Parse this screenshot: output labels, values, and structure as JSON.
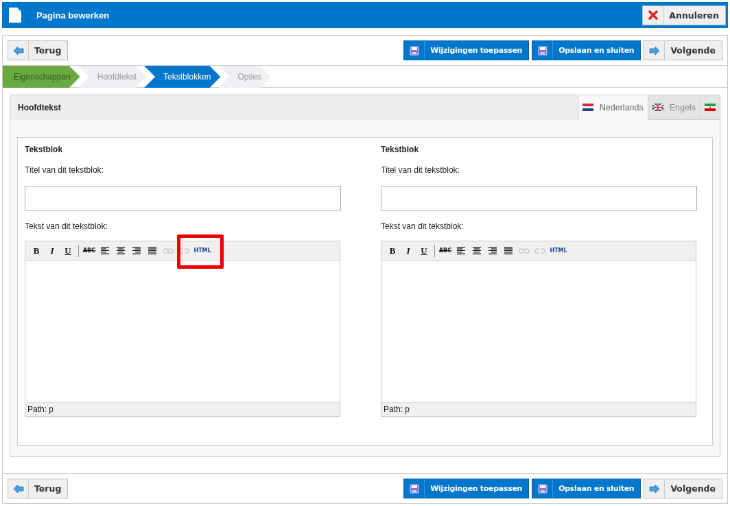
{
  "header": {
    "title": "Pagina bewerken",
    "cancel": "Annuleren"
  },
  "top_actions": {
    "back": "Terug",
    "apply": "Wijzigingen toepassen",
    "save_close": "Opslaan en sluiten",
    "next": "Volgende"
  },
  "steps": [
    {
      "label": "Eigenschappen",
      "done": true,
      "selected": false
    },
    {
      "label": "Hoofdtekst",
      "done": false,
      "selected": false
    },
    {
      "label": "Tekstblokken",
      "done": false,
      "selected": true
    },
    {
      "label": "Opties",
      "done": false,
      "selected": false
    }
  ],
  "panel": {
    "title": "Hoofdtekst",
    "languages": [
      {
        "kind": "nl",
        "label": "Nederlands",
        "selected": true
      },
      {
        "kind": "gb",
        "label": "Engels",
        "selected": false
      },
      {
        "kind": "ir",
        "selected": false
      }
    ]
  },
  "blocks": [
    {
      "heading": "Tekstblok",
      "title_label": "Titel van dit tekstblok:",
      "text_label": "Tekst van dit tekstblok:",
      "path": "Path: p",
      "highlighted": true,
      "tools": [
        {
          "kind": "bold",
          "label": "B",
          "disabled": false
        },
        {
          "kind": "italic",
          "label": "I",
          "disabled": false
        },
        {
          "kind": "underline",
          "label": "U",
          "disabled": false
        },
        {
          "kind": "separator"
        },
        {
          "kind": "strike",
          "label": "ABC",
          "disabled": false
        },
        {
          "kind": "align-left",
          "disabled": false
        },
        {
          "kind": "align-center",
          "disabled": false
        },
        {
          "kind": "align-right",
          "disabled": false
        },
        {
          "kind": "justify",
          "disabled": false
        },
        {
          "kind": "link",
          "disabled": true
        },
        {
          "kind": "unlink",
          "disabled": true
        },
        {
          "kind": "html",
          "label": "HTML",
          "disabled": false
        }
      ]
    },
    {
      "heading": "Tekstblok",
      "title_label": "Titel van dit tekstblok:",
      "text_label": "Tekst van dit tekstblok:",
      "path": "Path: p",
      "highlighted": false,
      "tools": [
        {
          "kind": "bold",
          "label": "B",
          "disabled": false
        },
        {
          "kind": "italic",
          "label": "I",
          "disabled": false
        },
        {
          "kind": "underline",
          "label": "U",
          "disabled": false
        },
        {
          "kind": "separator"
        },
        {
          "kind": "strike",
          "label": "ABC",
          "disabled": false
        },
        {
          "kind": "align-left",
          "disabled": false
        },
        {
          "kind": "align-center",
          "disabled": false
        },
        {
          "kind": "align-right",
          "disabled": false
        },
        {
          "kind": "justify",
          "disabled": false
        },
        {
          "kind": "link",
          "disabled": true
        },
        {
          "kind": "unlink",
          "disabled": true
        },
        {
          "kind": "html",
          "label": "HTML",
          "disabled": false
        }
      ]
    }
  ],
  "bottom_actions": {
    "back": "Terug",
    "apply": "Wijzigingen toepassen",
    "save_close": "Opslaan en sluiten",
    "next": "Volgende"
  }
}
